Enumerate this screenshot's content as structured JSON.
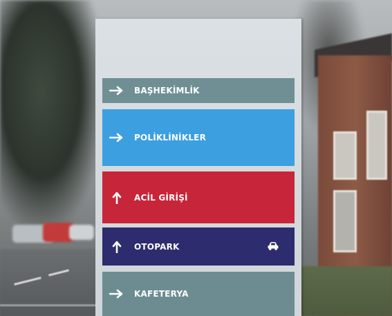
{
  "sign": {
    "panels": [
      {
        "label": "BAŞHEKİMLİK",
        "direction": "right",
        "icon": "arrow-right-icon",
        "color": "#6f8f95"
      },
      {
        "label": "POLİKLİNİKLER",
        "direction": "right",
        "icon": "arrow-right-icon",
        "color": "#3b9fe0"
      },
      {
        "label": "ACİL GİRİŞİ",
        "direction": "up",
        "icon": "arrow-up-icon",
        "color": "#c7253a"
      },
      {
        "label": "OTOPARK",
        "direction": "up",
        "icon": "arrow-up-icon",
        "extra_icon": "car-icon",
        "color": "#2d2c6e"
      },
      {
        "label": "KAFETERYA",
        "direction": "right",
        "icon": "arrow-right-icon",
        "color": "#6c8c91"
      }
    ]
  }
}
